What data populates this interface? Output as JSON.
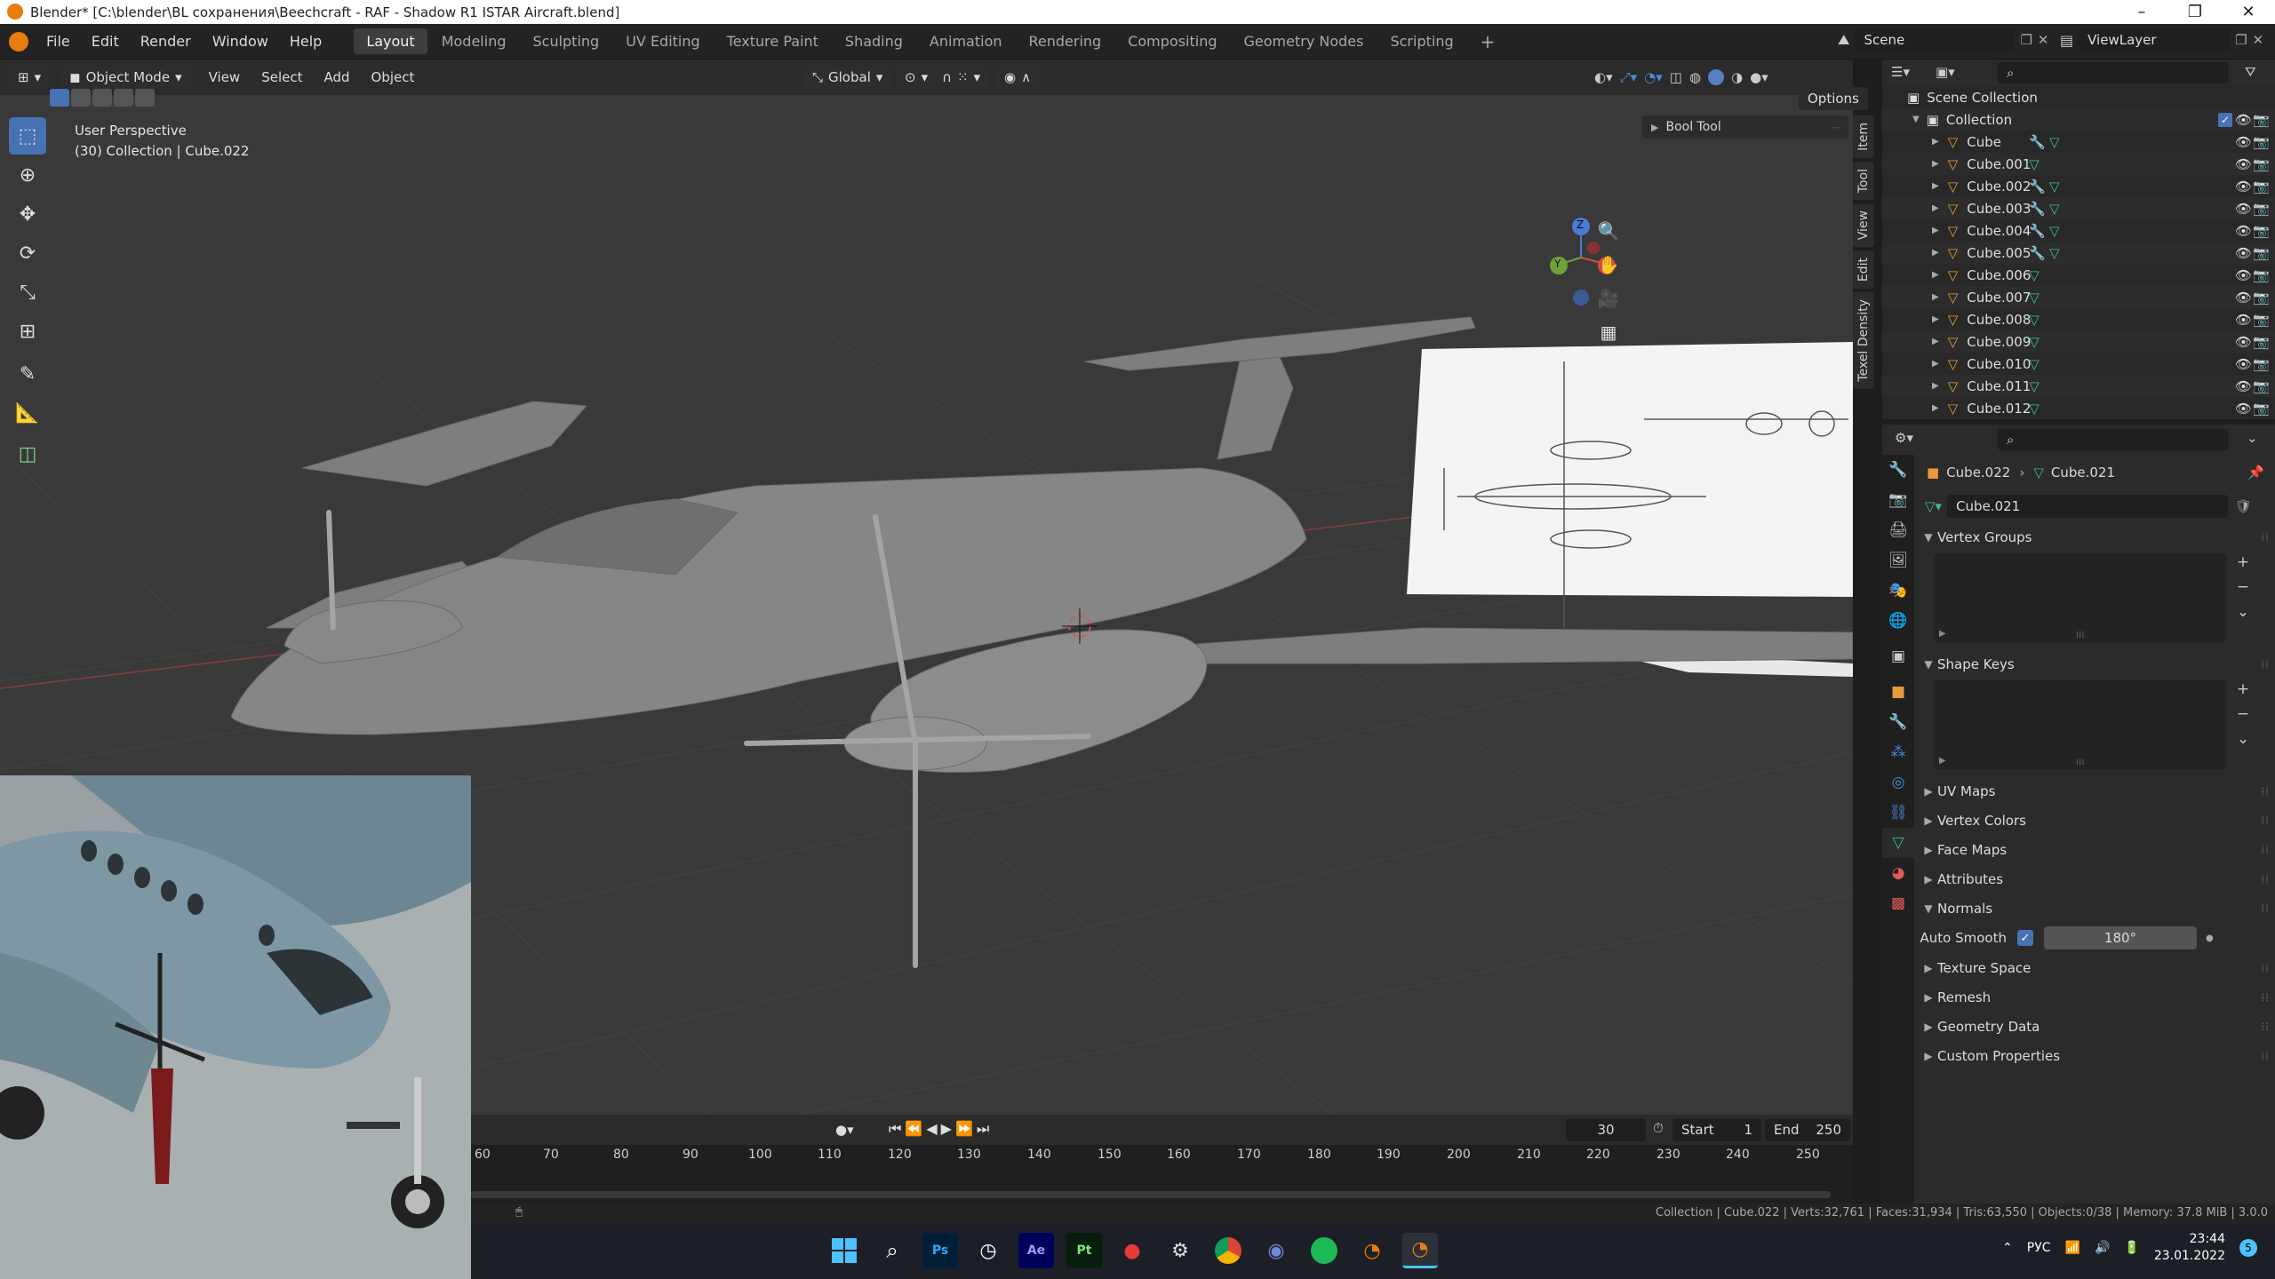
{
  "window": {
    "title": "Blender* [C:\\blender\\BL сохранения\\Beechcraft - RAF - Shadow R1 ISTAR Aircraft.blend]",
    "minimize": "–",
    "maximize": "❐",
    "close": "✕"
  },
  "menu": {
    "items": [
      "File",
      "Edit",
      "Render",
      "Window",
      "Help"
    ]
  },
  "workspaces": {
    "tabs": [
      "Layout",
      "Modeling",
      "Sculpting",
      "UV Editing",
      "Texture Paint",
      "Shading",
      "Animation",
      "Rendering",
      "Compositing",
      "Geometry Nodes",
      "Scripting"
    ],
    "active": "Layout",
    "add": "+"
  },
  "scene": {
    "name": "Scene",
    "view_layer": "ViewLayer"
  },
  "viewport_header": {
    "mode": "Object Mode",
    "menus": [
      "View",
      "Select",
      "Add",
      "Object"
    ],
    "transform_orientation": "Global",
    "options": "Options"
  },
  "viewport": {
    "perspective": "User Perspective",
    "collection_info": "(30) Collection | Cube.022",
    "npanel_tabs": [
      "Item",
      "Tool",
      "View",
      "Edit",
      "Texel Density"
    ],
    "bool_tool": "Bool Tool",
    "gizmo_axes": {
      "z": "Z",
      "y": "Y",
      "x": "X"
    }
  },
  "timeline": {
    "current_frame": "30",
    "start_label": "Start",
    "start": "1",
    "end_label": "End",
    "end": "250",
    "ruler": [
      "60",
      "70",
      "80",
      "90",
      "100",
      "110",
      "120",
      "130",
      "140",
      "150",
      "160",
      "170",
      "180",
      "190",
      "200",
      "210",
      "220",
      "230",
      "240",
      "250"
    ]
  },
  "statusbar": {
    "text": "Collection | Cube.022 | Verts:32,761 | Faces:31,934 | Tris:63,550 | Objects:0/38 | Memory: 37.8 MiB | 3.0.0"
  },
  "outliner": {
    "root": "Scene Collection",
    "collection": "Collection",
    "items": [
      {
        "name": "Cube",
        "modifier": true
      },
      {
        "name": "Cube.001",
        "modifier": false
      },
      {
        "name": "Cube.002",
        "modifier": true
      },
      {
        "name": "Cube.003",
        "modifier": true
      },
      {
        "name": "Cube.004",
        "modifier": true
      },
      {
        "name": "Cube.005",
        "modifier": true
      },
      {
        "name": "Cube.006",
        "modifier": false
      },
      {
        "name": "Cube.007",
        "modifier": false
      },
      {
        "name": "Cube.008",
        "modifier": false
      },
      {
        "name": "Cube.009",
        "modifier": false
      },
      {
        "name": "Cube.010",
        "modifier": false
      },
      {
        "name": "Cube.011",
        "modifier": false
      },
      {
        "name": "Cube.012",
        "modifier": false
      }
    ]
  },
  "properties": {
    "breadcrumb_object": "Cube.022",
    "breadcrumb_mesh": "Cube.021",
    "mesh_name": "Cube.021",
    "panels": {
      "vertex_groups": "Vertex Groups",
      "shape_keys": "Shape Keys",
      "uv_maps": "UV Maps",
      "vertex_colors": "Vertex Colors",
      "face_maps": "Face Maps",
      "attributes": "Attributes",
      "normals": "Normals",
      "texture_space": "Texture Space",
      "remesh": "Remesh",
      "geometry_data": "Geometry Data",
      "custom_properties": "Custom Properties"
    },
    "auto_smooth_label": "Auto Smooth",
    "auto_smooth_angle": "180°",
    "auto_smooth_checked": true
  },
  "taskbar": {
    "apps": [
      "Start",
      "Search",
      "Ps",
      "Clock",
      "Ae",
      "Pt",
      "Rec",
      "Steam",
      "Chrome",
      "Discord",
      "Spotify",
      "Blender",
      "Blender"
    ],
    "lang": "РУС",
    "time": "23:44",
    "date": "23.01.2022",
    "notifications": "5"
  },
  "colors": {
    "accent": "#4772b3",
    "viewport_bg": "#393939",
    "header_bg": "#2b2b2b",
    "mesh_color": "#8a8a8a",
    "object_icon": "#e89a3c",
    "mesh_icon": "#3fbf7f"
  }
}
